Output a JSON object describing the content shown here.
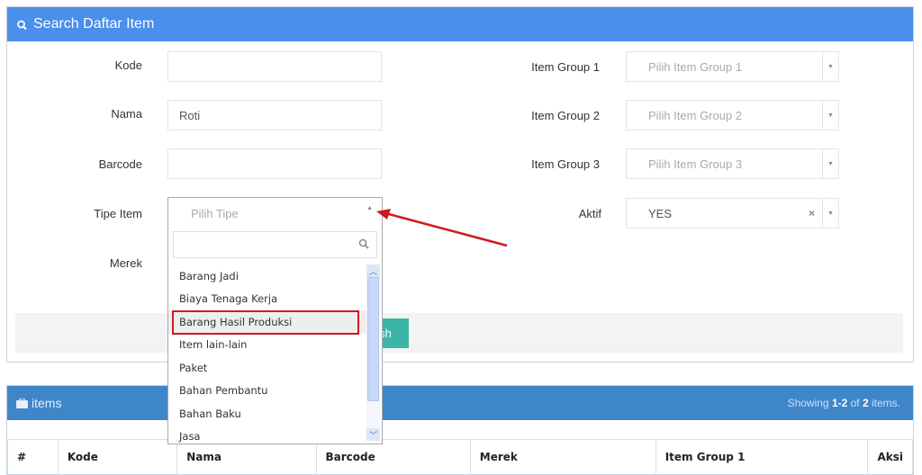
{
  "search_panel": {
    "title": "Search Daftar Item",
    "icon": "search-icon",
    "fields": {
      "kode": {
        "label": "Kode",
        "value": ""
      },
      "nama": {
        "label": "Nama",
        "value": "Roti"
      },
      "barcode": {
        "label": "Barcode",
        "value": ""
      },
      "tipe_item": {
        "label": "Tipe Item",
        "placeholder": "Pilih Tipe"
      },
      "merek": {
        "label": "Merek"
      },
      "item_group_1": {
        "label": "Item Group 1",
        "placeholder": "Pilih Item Group 1"
      },
      "item_group_2": {
        "label": "Item Group 2",
        "placeholder": "Pilih Item Group 2"
      },
      "item_group_3": {
        "label": "Item Group 3",
        "placeholder": "Pilih Item Group 3"
      },
      "aktif": {
        "label": "Aktif",
        "value": "YES",
        "clear": "×"
      }
    },
    "refresh_label": "sh"
  },
  "tipe_dropdown": {
    "search_value": "",
    "options": [
      "Barang Jadi",
      "Biaya Tenaga Kerja",
      "Barang Hasil Produksi",
      "Item lain-lain",
      "Paket",
      "Bahan Pembantu",
      "Bahan Baku",
      "Jasa"
    ],
    "highlighted": "Barang Hasil Produksi"
  },
  "items_panel": {
    "title": "items",
    "icon": "briefcase-icon",
    "showing_prefix": "Showing ",
    "showing_range": "1-2",
    "showing_of": " of ",
    "showing_total": "2",
    "showing_suffix": " items.",
    "columns": [
      "#",
      "Kode",
      "Nama",
      "Barcode",
      "Merek",
      "Item Group 1",
      "Aksi"
    ]
  },
  "annotation": {
    "arrow_color": "#d0191f",
    "highlight_color": "#d0191f"
  }
}
